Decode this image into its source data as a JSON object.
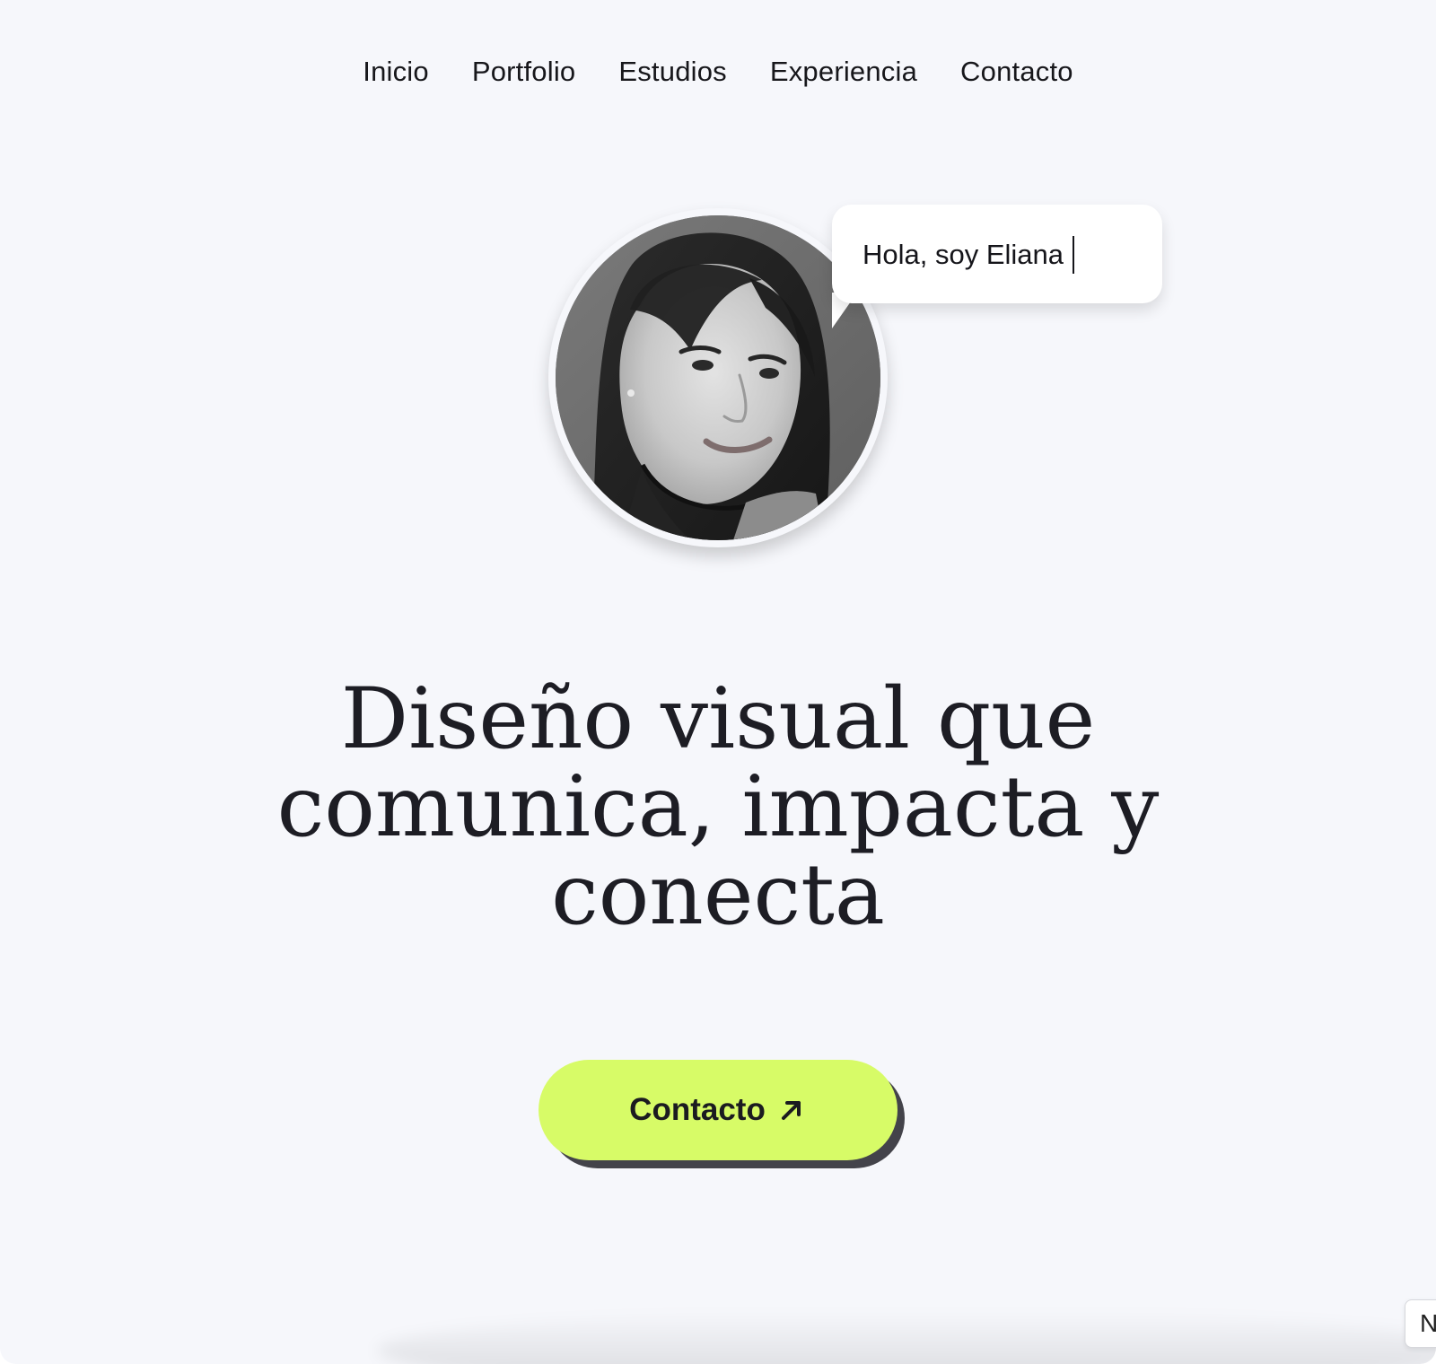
{
  "nav": {
    "items": [
      {
        "label": "Inicio"
      },
      {
        "label": "Portfolio"
      },
      {
        "label": "Estudios"
      },
      {
        "label": "Experiencia"
      },
      {
        "label": "Contacto"
      }
    ]
  },
  "hero": {
    "greeting": "Hola, soy Eliana",
    "headline_lines": [
      "Diseño visual que",
      "comunica, impacta y",
      "conecta"
    ],
    "cta_label": "Contacto",
    "cta_icon": "arrow-up-right-icon"
  },
  "side_tab": {
    "label": "N"
  },
  "colors": {
    "background": "#f6f7fb",
    "text": "#1d1d24",
    "accent": "#d7fb67",
    "accent_shadow": "#43434a",
    "bubble": "#ffffff"
  },
  "avatar": {
    "icon": "portrait-photo"
  }
}
